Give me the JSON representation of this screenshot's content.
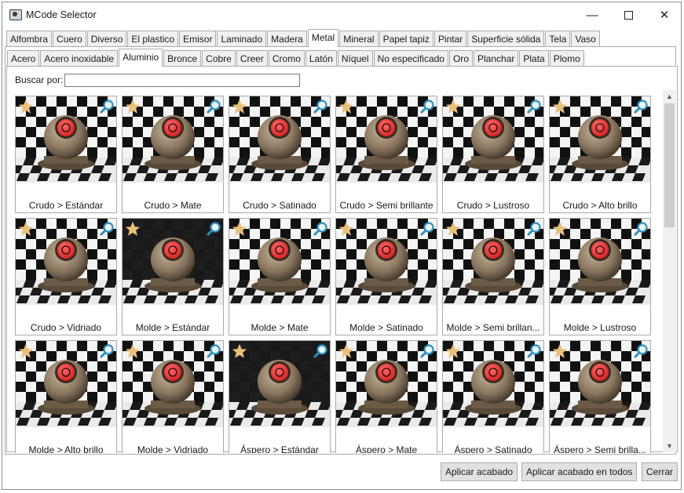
{
  "window": {
    "title": "MCode Selector",
    "app_icon": "camera-icon"
  },
  "category_tabs": [
    "Alfombra",
    "Cuero",
    "Diverso",
    "El plastico",
    "Emisor",
    "Laminado",
    "Madera",
    "Metal",
    "Mineral",
    "Papel tapiz",
    "Pintar",
    "Superficie sólida",
    "Tela",
    "Vaso"
  ],
  "category_active": "Metal",
  "subcategory_tabs": [
    "Acero",
    "Acero inoxidable",
    "Aluminio",
    "Bronce",
    "Cobre",
    "Creer",
    "Cromo",
    "Latón",
    "Níquel",
    "No especificado",
    "Oro",
    "Planchar",
    "Plata",
    "Plomo"
  ],
  "subcategory_active": "Aluminio",
  "search": {
    "label": "Buscar por:",
    "value": ""
  },
  "materials": [
    {
      "label": "Crudo > Estándar",
      "bg": "checker"
    },
    {
      "label": "Crudo > Mate",
      "bg": "checker"
    },
    {
      "label": "Crudo > Satinado",
      "bg": "checker"
    },
    {
      "label": "Crudo > Semi brillante",
      "bg": "checker"
    },
    {
      "label": "Crudo > Lustroso",
      "bg": "checker"
    },
    {
      "label": "Crudo > Alto brillo",
      "bg": "checker"
    },
    {
      "label": "Crudo > Vidriado",
      "bg": "checker"
    },
    {
      "label": "Molde > Estándar",
      "bg": "dark"
    },
    {
      "label": "Molde > Mate",
      "bg": "checker"
    },
    {
      "label": "Molde > Satinado",
      "bg": "checker"
    },
    {
      "label": "Molde > Semi brillan...",
      "bg": "checker"
    },
    {
      "label": "Molde > Lustroso",
      "bg": "checker"
    },
    {
      "label": "Molde > Alto brillo",
      "bg": "checker"
    },
    {
      "label": "Molde > Vidriado",
      "bg": "checker"
    },
    {
      "label": "Áspero > Estándar",
      "bg": "dark"
    },
    {
      "label": "Áspero > Mate",
      "bg": "checker"
    },
    {
      "label": "Áspero > Satinado",
      "bg": "checker"
    },
    {
      "label": "Áspero > Semi brilla...",
      "bg": "checker"
    }
  ],
  "buttons": {
    "apply": "Aplicar acabado",
    "apply_all": "Aplicar acabado en todos",
    "close": "Cerrar"
  },
  "colors": {
    "star": "#e8c07a",
    "zoom": "#2e8fbf",
    "sphere": "#8a7660",
    "red": "#d42020"
  }
}
